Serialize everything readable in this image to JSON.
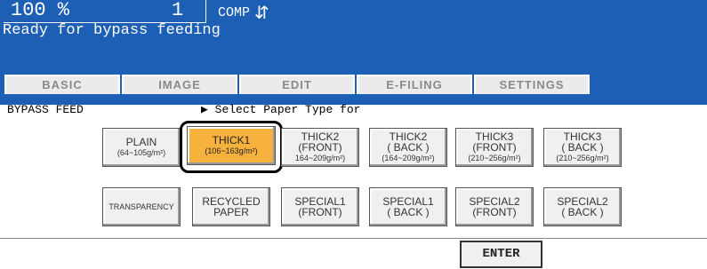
{
  "header": {
    "ratio": "100  %",
    "count": "1",
    "mode": "COMP",
    "mode_icon": "sort-icon",
    "status": "Ready for bypass feeding"
  },
  "tabs": [
    {
      "label": "BASIC"
    },
    {
      "label": "IMAGE"
    },
    {
      "label": "EDIT"
    },
    {
      "label": "E-FILING"
    },
    {
      "label": "SETTINGS"
    }
  ],
  "section": {
    "title": "BYPASS FEED",
    "prompt_arrow": "▶",
    "prompt": "Select Paper Type for"
  },
  "paper_types_row1": [
    {
      "line1": "PLAIN",
      "line2": "(64~105g/m²)",
      "selected": false
    },
    {
      "line1": "THICK1",
      "line2": "(106~163g/m²)",
      "selected": true
    },
    {
      "line1": "THICK2",
      "line2": "(FRONT)",
      "line3": "164~209g/m²)",
      "selected": false
    },
    {
      "line1": "THICK2",
      "line2": "( BACK )",
      "line3": "(164~209g/m²)",
      "selected": false
    },
    {
      "line1": "THICK3",
      "line2": "(FRONT)",
      "line3": "(210~256g/m²)",
      "selected": false
    },
    {
      "line1": "THICK3",
      "line2": "( BACK )",
      "line3": "(210~256g/m²)",
      "selected": false
    }
  ],
  "paper_types_row2": [
    {
      "line1": "TRANSPARENCY"
    },
    {
      "line1": "RECYCLED",
      "line2": "PAPER"
    },
    {
      "line1": "SPECIAL1",
      "line2": "(FRONT)"
    },
    {
      "line1": "SPECIAL1",
      "line2": "( BACK )"
    },
    {
      "line1": "SPECIAL2",
      "line2": "(FRONT)"
    },
    {
      "line1": "SPECIAL2",
      "line2": "( BACK )"
    }
  ],
  "enter_label": "ENTER",
  "colors": {
    "header_bg": "#1d5fb4",
    "selected_bg": "#f7b23e"
  }
}
